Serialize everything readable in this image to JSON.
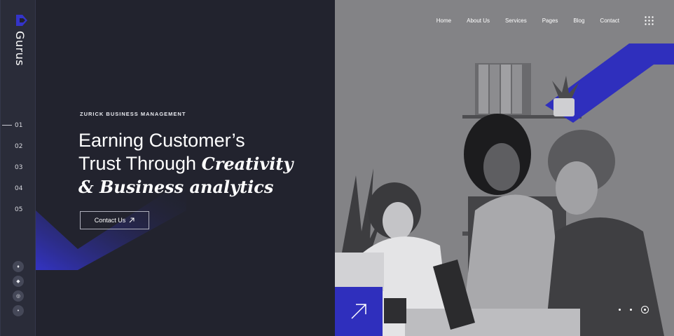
{
  "brand": {
    "name": "Gurus",
    "logo_icon": "gurus-logo-icon"
  },
  "slides": {
    "items": [
      "01",
      "02",
      "03",
      "04",
      "05"
    ],
    "active_index": 0
  },
  "socials": [
    {
      "name": "twitter-icon",
      "glyph": "♦"
    },
    {
      "name": "facebook-icon",
      "glyph": "◆"
    },
    {
      "name": "instagram-icon",
      "glyph": "◎"
    },
    {
      "name": "dribbble-icon",
      "glyph": "•"
    }
  ],
  "hero": {
    "eyebrow": "ZURICK BUSINESS MANAGEMENT",
    "headline_line1": "Earning Customer’s",
    "headline_line2_plain": "Trust Through ",
    "headline_line2_italic": "Creativity",
    "headline_line3_italic": "& Business analytics",
    "cta_label": "Contact Us",
    "cta_icon": "arrow-up-right-icon"
  },
  "nav": {
    "items": [
      "Home",
      "About Us",
      "Services",
      "Pages",
      "Blog",
      "Contact"
    ],
    "menu_icon": "grid-menu-icon"
  },
  "photo": {
    "corner_icon": "arrow-up-right-icon",
    "slider_dots": 3,
    "active_dot": 2
  },
  "colors": {
    "accent": "#2f2fbd",
    "background": "#22232e",
    "rail": "#2a2c39"
  }
}
